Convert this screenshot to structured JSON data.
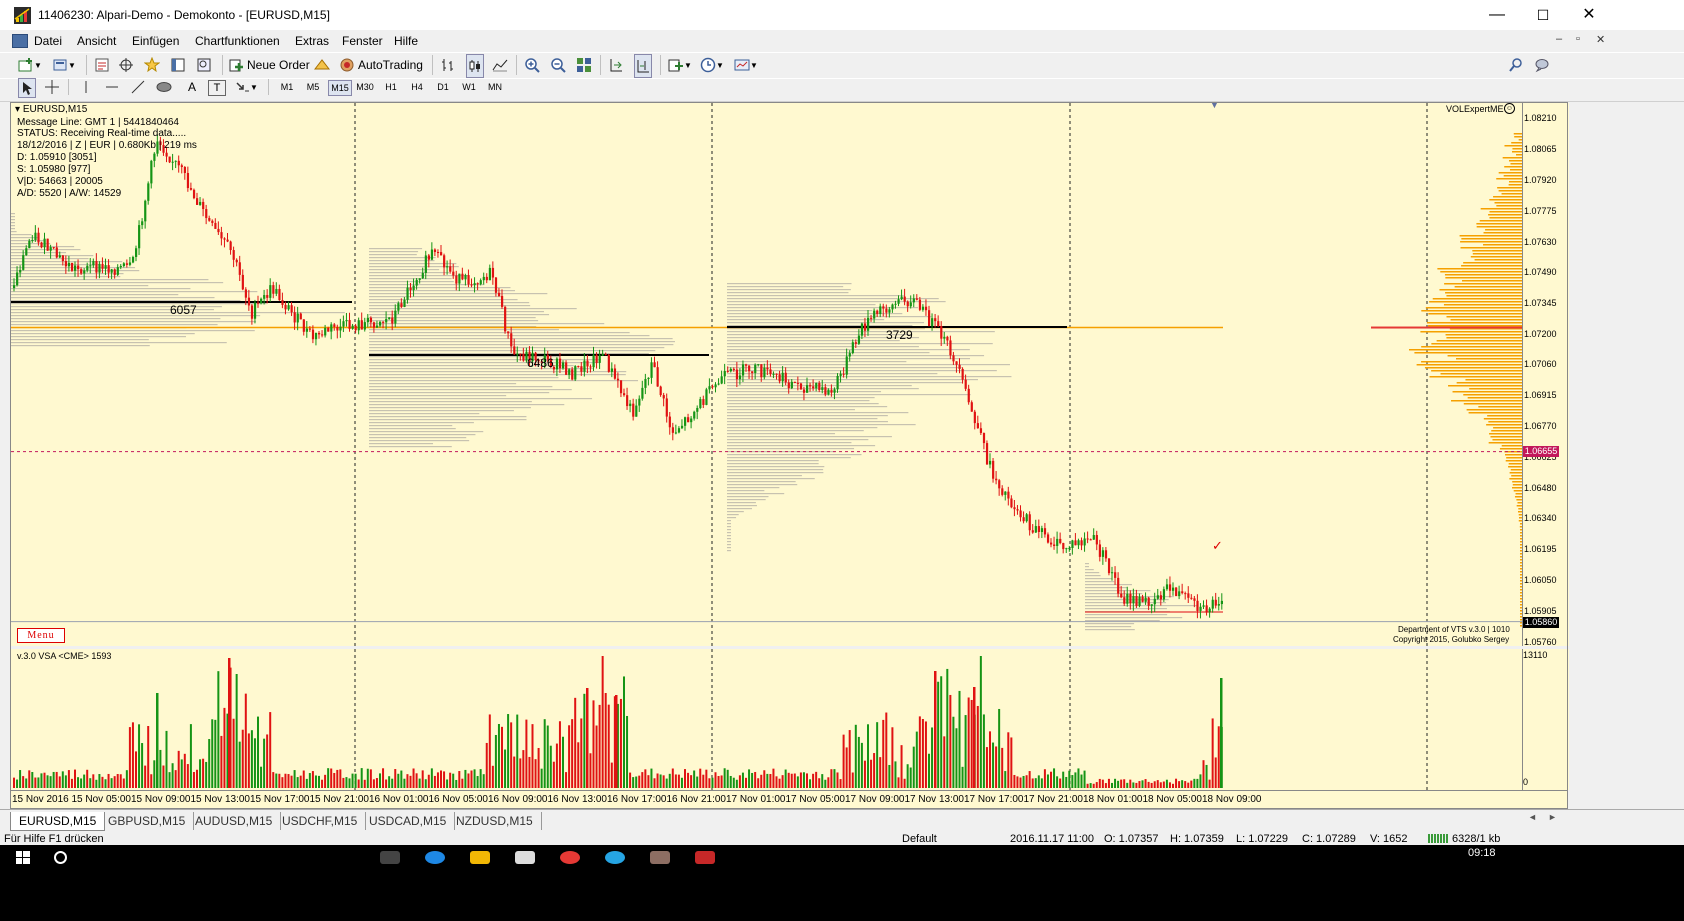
{
  "window": {
    "title": "11406230: Alpari-Demo - Demokonto - [EURUSD,M15]",
    "minimize": "—",
    "maximize": "☐",
    "close": "✕"
  },
  "menu": {
    "items": [
      "Datei",
      "Ansicht",
      "Einfügen",
      "Chartfunktionen",
      "Extras",
      "Fenster",
      "Hilfe"
    ]
  },
  "toolbar": {
    "new_order": "Neue Order",
    "auto_trading": "AutoTrading",
    "text_tool": "A",
    "label_tool": "T"
  },
  "timeframes": [
    "M1",
    "M5",
    "M15",
    "M30",
    "H1",
    "H4",
    "D1",
    "W1",
    "MN"
  ],
  "active_timeframe": "M15",
  "chart": {
    "symbol_label": "EURUSD,M15",
    "info_lines": [
      "Message Line: GMT 1 | 5441840464",
      "STATUS:  Receiving Real-time data.....",
      "18/12/2016 | Z | EUR | 0.680Kb | 219 ms",
      "D: 1.05910  [3051]",
      "S: 1.05980  [977]",
      "V|D: 54663 | 20005",
      "A/D: 5520 | A/W: 14529"
    ],
    "expert_label": "VOLExpertME",
    "menu_button": "Menu",
    "copyright_lines": [
      "Department of VTS  v.3.0 | 1010",
      "Copyright 2015, Golubko Sergey"
    ],
    "level_labels": [
      "6057",
      "6486",
      "3729"
    ],
    "price_labels": [
      "1.08210",
      "1.08065",
      "1.07920",
      "1.07775",
      "1.07630",
      "1.07490",
      "1.07345",
      "1.07200",
      "1.07060",
      "1.06915",
      "1.06770",
      "1.06625",
      "1.06480",
      "1.06340",
      "1.06195",
      "1.06050",
      "1.05905",
      "1.05760"
    ],
    "price_min": 1.0576,
    "price_max": 1.0821,
    "highlight_price": "1.06655",
    "current_price": "1.05860",
    "orange_level": 1.07235,
    "red_dotted_level": 1.06655,
    "current_level": 1.0586,
    "accent_orange": "#f5a000",
    "bull_color": "#159415",
    "bear_color": "#e01212",
    "background": "#fff9d0"
  },
  "volume": {
    "label": "v.3.0 VSA <CME> 1593",
    "axis_max": "13110",
    "axis_min": "0"
  },
  "time_labels": [
    "15 Nov 2016",
    "15 Nov 05:00",
    "15 Nov 09:00",
    "15 Nov 13:00",
    "15 Nov 17:00",
    "15 Nov 21:00",
    "16 Nov 01:00",
    "16 Nov 05:00",
    "16 Nov 09:00",
    "16 Nov 13:00",
    "16 Nov 17:00",
    "16 Nov 21:00",
    "17 Nov 01:00",
    "17 Nov 05:00",
    "17 Nov 09:00",
    "17 Nov 13:00",
    "17 Nov 17:00",
    "17 Nov 21:00",
    "18 Nov 01:00",
    "18 Nov 05:00",
    "18 Nov 09:00"
  ],
  "tabs": [
    "EURUSD,M15",
    "GBPUSD,M15",
    "AUDUSD,M15",
    "USDCHF,M15",
    "USDCAD,M15",
    "NZDUSD,M15"
  ],
  "active_tab": "EURUSD,M15",
  "status": {
    "help": "Für Hilfe F1 drücken",
    "profile": "Default",
    "datetime": "2016.11.17 11:00",
    "open": "O: 1.07357",
    "high": "H: 1.07359",
    "low": "L: 1.07229",
    "close": "C: 1.07289",
    "volume": "V: 1652",
    "traffic": "6328/1 kb"
  },
  "taskbar": {
    "time": "09:18"
  }
}
